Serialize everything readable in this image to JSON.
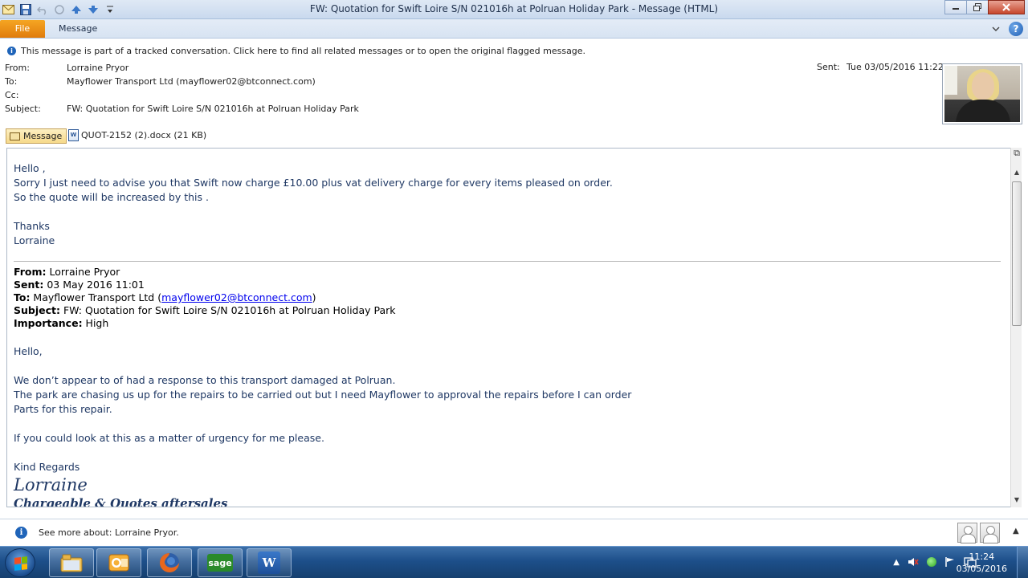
{
  "window": {
    "title": "FW: Quotation for Swift Loire S/N 021016h at Polruan Holiday Park  -  Message (HTML)"
  },
  "ribbon": {
    "file_tab": "File",
    "message_tab": "Message"
  },
  "infobar": {
    "text": "This message is part of a tracked conversation. Click here to find all related messages or to open the original flagged message."
  },
  "header": {
    "from_label": "From:",
    "from_value": "Lorraine Pryor",
    "to_label": "To:",
    "to_value": "Mayflower Transport Ltd (mayflower02@btconnect.com)",
    "cc_label": "Cc:",
    "cc_value": "",
    "subject_label": "Subject:",
    "subject_value": "FW: Quotation for Swift Loire S/N 021016h at Polruan Holiday Park",
    "sent_label": "Sent:",
    "sent_value": "Tue 03/05/2016 11:22"
  },
  "attachments": {
    "message_label": "Message",
    "file_label": "QUOT-2152 (2).docx (21 KB)",
    "file_icon": "W"
  },
  "body": {
    "greeting": "Hello ,",
    "line1": "Sorry I just need to advise you that Swift now charge £10.00 plus vat delivery charge for every items pleased on order.",
    "line2": "So the quote will be increased by this .",
    "thanks": "Thanks",
    "name": "Lorraine"
  },
  "forwarded": {
    "from_label": "From:",
    "from_value": " Lorraine Pryor",
    "sent_label": "Sent:",
    "sent_value": " 03 May 2016 11:01",
    "to_label": "To:",
    "to_value": " Mayflower Transport Ltd (",
    "to_link": "mayflower02@btconnect.com",
    "to_close": ")",
    "subject_label": "Subject:",
    "subject_value": " FW: Quotation for Swift Loire S/N 021016h at Polruan Holiday Park",
    "importance_label": "Importance:",
    "importance_value": " High"
  },
  "body2": {
    "greeting": "Hello,",
    "p1": "We don’t appear to of had a response  to this transport damaged at Polruan.",
    "p2": "The park are chasing us up for the repairs to be carried out but I need Mayflower to approval the repairs before I can order",
    "p3": "Parts for this repair.",
    "p4": "If you could look at this as a matter of urgency for me please.",
    "regards": "Kind Regards",
    "sig_name": "Lorraine",
    "sig_title": "Chargeable & Quotes aftersales"
  },
  "people_pane": {
    "text": "See more about: Lorraine Pryor."
  },
  "taskbar": {
    "time": "11:24",
    "date": "03/05/2016",
    "sage_label": "sage",
    "word_label": "W"
  },
  "colors": {
    "body_text": "#1f3864",
    "file_tab": "#e07b0c",
    "link": "#0000ee"
  }
}
